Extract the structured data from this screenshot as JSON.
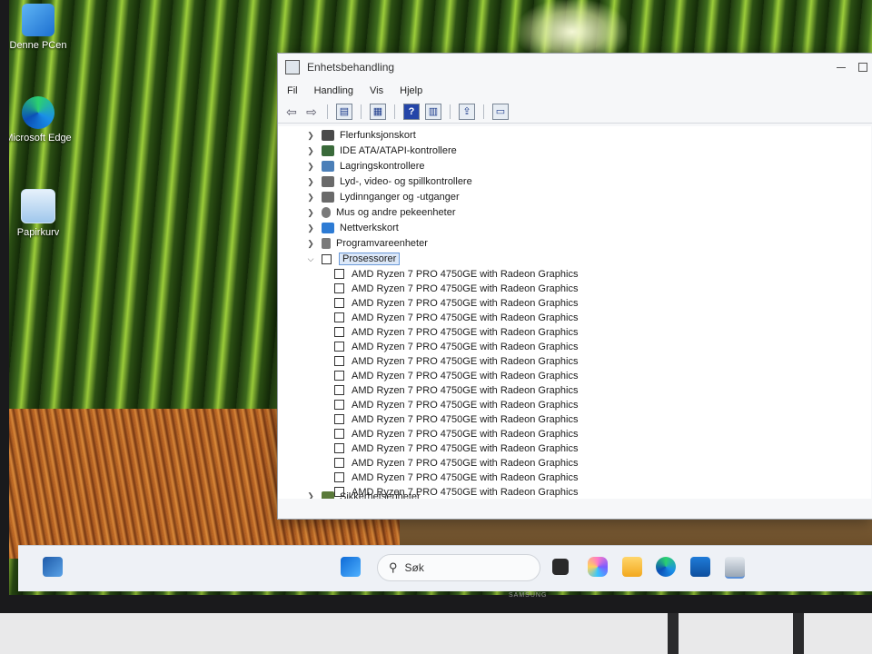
{
  "desktop": {
    "icons": [
      {
        "label": "Denne PCen",
        "icon": "computer-icon"
      },
      {
        "label": "Microsoft Edge",
        "icon": "edge-icon"
      },
      {
        "label": "Papirkurv",
        "icon": "recycle-bin-icon"
      }
    ]
  },
  "window": {
    "title": "Enhetsbehandling",
    "menu": [
      "Fil",
      "Handling",
      "Vis",
      "Hjelp"
    ],
    "tree": {
      "categories": [
        {
          "label": "Flerfunksjonskort",
          "expanded": false,
          "color": "#4a4a4a"
        },
        {
          "label": "IDE ATA/ATAPI-kontrollere",
          "expanded": false,
          "color": "#3a6a3a"
        },
        {
          "label": "Lagringskontrollere",
          "expanded": false,
          "color": "#4b7fb8"
        },
        {
          "label": "Lyd-, video- og spillkontrollere",
          "expanded": false,
          "color": "#6a6a6a"
        },
        {
          "label": "Lydinnganger og -utganger",
          "expanded": false,
          "color": "#6a6a6a"
        },
        {
          "label": "Mus og andre pekeenheter",
          "expanded": false,
          "color": "#7a7a7a"
        },
        {
          "label": "Nettverkskort",
          "expanded": false,
          "color": "#2d7bd4"
        },
        {
          "label": "Programvareenheter",
          "expanded": false,
          "color": "#7a7a7a"
        },
        {
          "label": "Prosessorer",
          "expanded": true,
          "color": "#333333"
        }
      ],
      "processors": [
        "AMD Ryzen 7 PRO 4750GE with Radeon Graphics",
        "AMD Ryzen 7 PRO 4750GE with Radeon Graphics",
        "AMD Ryzen 7 PRO 4750GE with Radeon Graphics",
        "AMD Ryzen 7 PRO 4750GE with Radeon Graphics",
        "AMD Ryzen 7 PRO 4750GE with Radeon Graphics",
        "AMD Ryzen 7 PRO 4750GE with Radeon Graphics",
        "AMD Ryzen 7 PRO 4750GE with Radeon Graphics",
        "AMD Ryzen 7 PRO 4750GE with Radeon Graphics",
        "AMD Ryzen 7 PRO 4750GE with Radeon Graphics",
        "AMD Ryzen 7 PRO 4750GE with Radeon Graphics",
        "AMD Ryzen 7 PRO 4750GE with Radeon Graphics",
        "AMD Ryzen 7 PRO 4750GE with Radeon Graphics",
        "AMD Ryzen 7 PRO 4750GE with Radeon Graphics",
        "AMD Ryzen 7 PRO 4750GE with Radeon Graphics",
        "AMD Ryzen 7 PRO 4750GE with Radeon Graphics",
        "AMD Ryzen 7 PRO 4750GE with Radeon Graphics"
      ],
      "partial_label": "Sikkerhetsenheter"
    }
  },
  "taskbar": {
    "search_placeholder": "Søk",
    "apps": [
      "widgets-icon",
      "start-icon",
      "task-view-icon",
      "copilot-icon",
      "file-explorer-icon",
      "edge-icon",
      "store-icon",
      "device-manager-icon"
    ]
  },
  "monitor": {
    "brand": "SAMSUNG"
  }
}
